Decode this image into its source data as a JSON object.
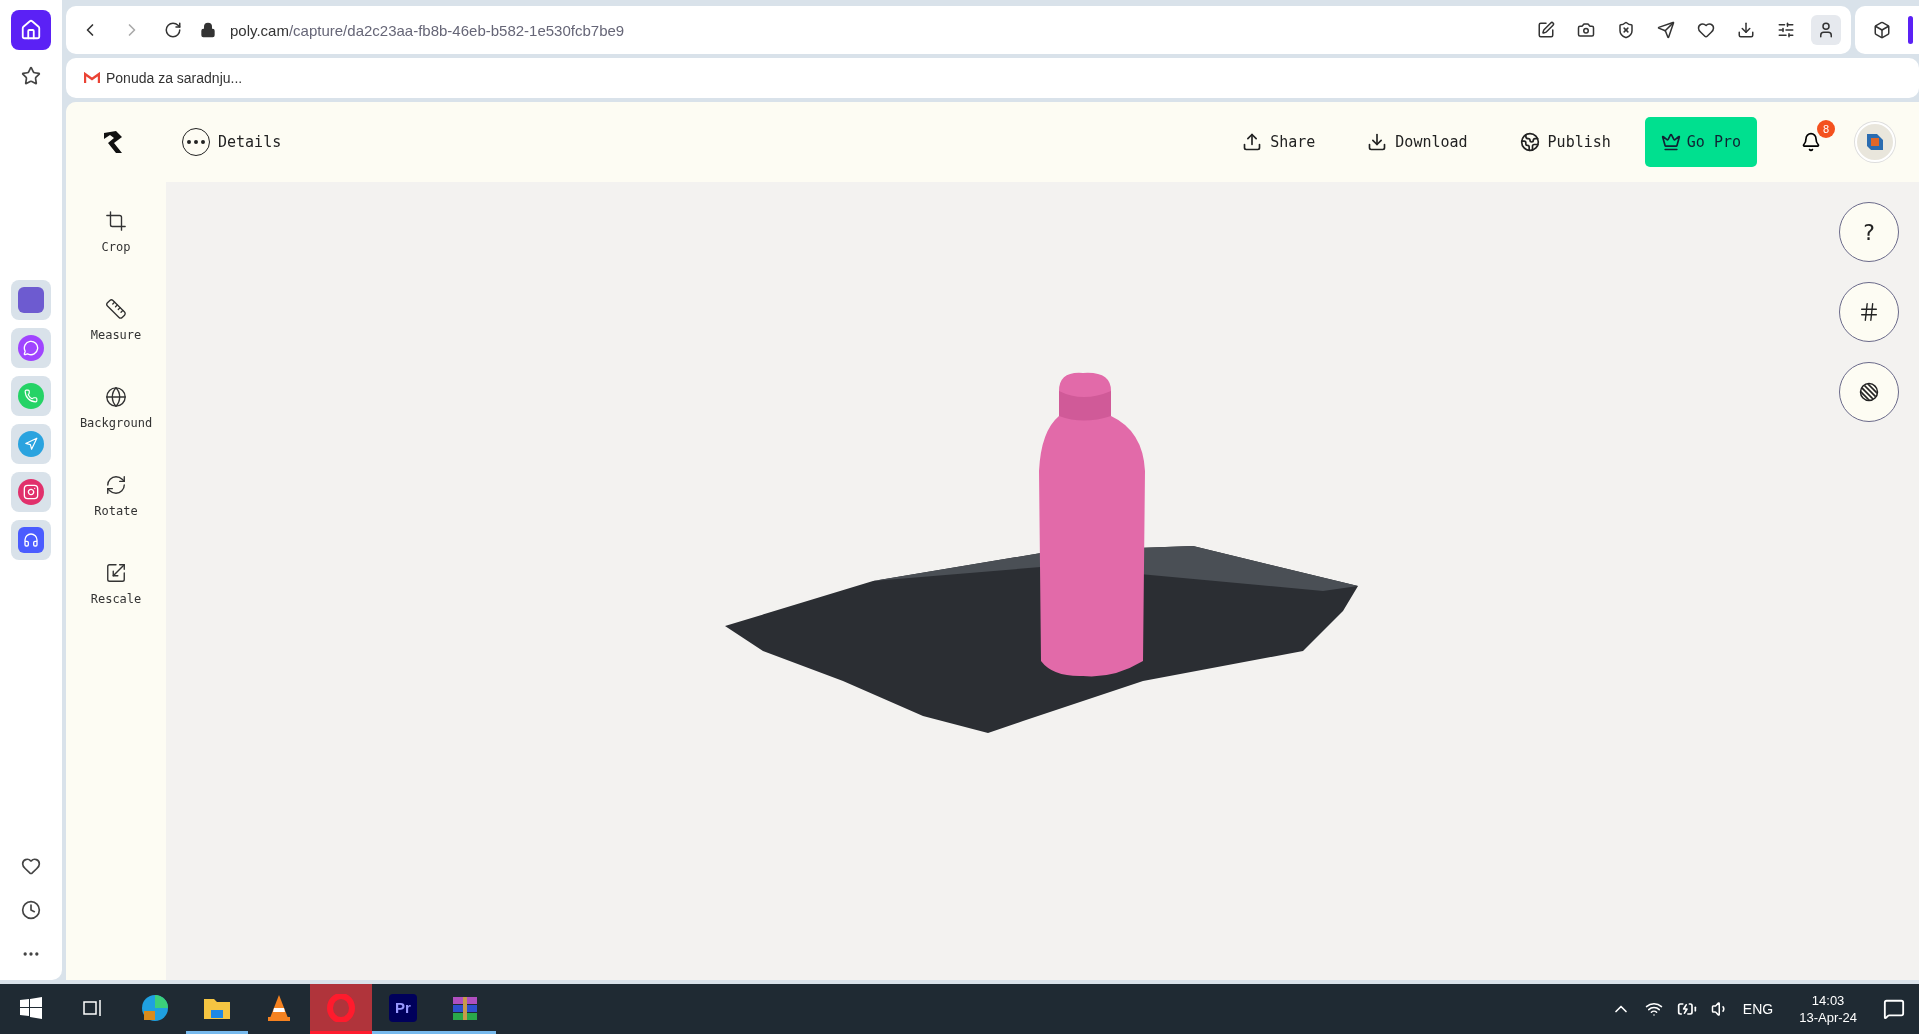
{
  "browser": {
    "url_host": "poly.cam",
    "url_path": "/capture/da2c23aa-fb8b-46eb-b582-1e530fcb7be9",
    "bookmarks": [
      {
        "label": "Ponuda za saradnju..."
      }
    ],
    "side_apps": [
      {
        "kind": "app",
        "color": "#6d5bd0"
      },
      {
        "kind": "messenger",
        "color": "#a044ff"
      },
      {
        "kind": "whatsapp",
        "color": "#25d366"
      },
      {
        "kind": "telegram",
        "color": "#2aa3df"
      },
      {
        "kind": "instagram",
        "color": "#e1306c"
      },
      {
        "kind": "music",
        "color": "#4a5cff"
      }
    ]
  },
  "header": {
    "details": "Details",
    "actions": [
      {
        "kind": "share",
        "label": "Share"
      },
      {
        "kind": "download",
        "label": "Download"
      },
      {
        "kind": "publish",
        "label": "Publish"
      }
    ],
    "go_pro": "Go Pro",
    "notifications": "8"
  },
  "tools": [
    {
      "kind": "crop",
      "label": "Crop"
    },
    {
      "kind": "measure",
      "label": "Measure"
    },
    {
      "kind": "background",
      "label": "Background"
    },
    {
      "kind": "rotate",
      "label": "Rotate"
    },
    {
      "kind": "rescale",
      "label": "Rescale"
    }
  ],
  "view_controls": [
    {
      "kind": "help",
      "label": "?"
    },
    {
      "kind": "grid"
    },
    {
      "kind": "texture"
    }
  ],
  "taskbar": {
    "apps": [
      {
        "kind": "taskview",
        "running": false
      },
      {
        "kind": "edge",
        "running": false
      },
      {
        "kind": "files",
        "running": true
      },
      {
        "kind": "vlc",
        "running": false
      },
      {
        "kind": "opera",
        "running": true,
        "selected": true
      },
      {
        "kind": "premiere",
        "running": true,
        "label": "Pr"
      },
      {
        "kind": "winrar",
        "running": true
      }
    ],
    "language": "ENG",
    "time": "14:03",
    "date": "13-Apr-24"
  }
}
